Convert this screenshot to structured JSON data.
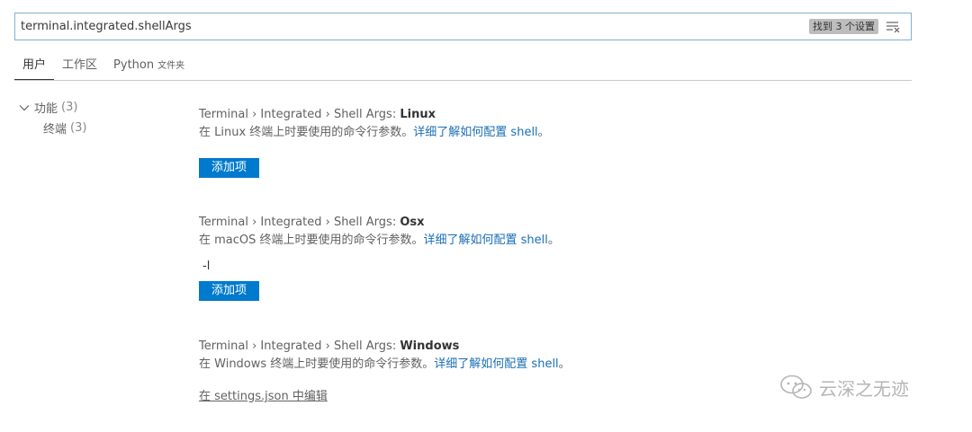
{
  "search": {
    "value": "terminal.integrated.shellArgs",
    "result_count": "找到 3 个设置",
    "clear_icon": "clear-filter-icon"
  },
  "tabs": [
    {
      "label": "用户",
      "active": true
    },
    {
      "label": "工作区",
      "active": false
    },
    {
      "label": "Python",
      "sub": "文件夹",
      "active": false
    }
  ],
  "toc": {
    "group": {
      "label": "功能",
      "count": "(3)",
      "icon": "chevron-down-icon"
    },
    "child": {
      "label": "终端",
      "count": "(3)"
    }
  },
  "settings": [
    {
      "path": "Terminal › Integrated › Shell Args: ",
      "leaf": "Linux",
      "desc_prefix": "在 Linux 终端上时要使用的命令行参数。",
      "desc_link": "详细了解如何配置 shell",
      "desc_suffix": "。",
      "items": [],
      "action_label": "添加项"
    },
    {
      "path": "Terminal › Integrated › Shell Args: ",
      "leaf": "Osx",
      "desc_prefix": "在 macOS 终端上时要使用的命令行参数。",
      "desc_link": "详细了解如何配置 shell",
      "desc_suffix": "。",
      "items": [
        "-l"
      ],
      "action_label": "添加项"
    },
    {
      "path": "Terminal › Integrated › Shell Args: ",
      "leaf": "Windows",
      "desc_prefix": "在 Windows 终端上时要使用的命令行参数。",
      "desc_link": "详细了解如何配置 shell",
      "desc_suffix": "。",
      "edit_link": "在 settings.json 中编辑"
    }
  ],
  "watermark": {
    "text": "云深之无迹",
    "icon": "wechat-icon"
  },
  "colors": {
    "accent": "#007acc",
    "link": "#1a6fb4",
    "focus_border": "#7fb0d6"
  }
}
